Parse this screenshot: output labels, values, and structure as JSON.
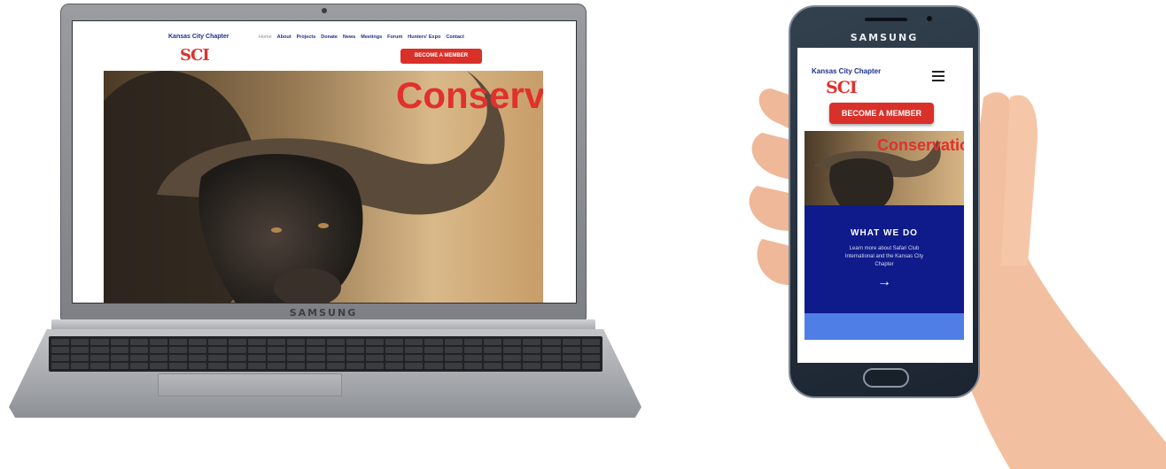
{
  "laptop": {
    "brand": "SAMSUNG",
    "site": {
      "chapter": "Kansas City Chapter",
      "logo": "SCI",
      "nav": [
        "Home",
        "About",
        "Projects",
        "Donate",
        "News",
        "Meetings",
        "Forum",
        "Hunters' Expo",
        "Contact"
      ],
      "active_nav": "Home",
      "cta": "BECOME A MEMBER",
      "hero_title": "Conservation"
    }
  },
  "phone": {
    "brand": "SAMSUNG",
    "site": {
      "chapter": "Kansas City Chapter",
      "logo": "SCI",
      "cta": "BECOME A MEMBER",
      "hero_title": "Conservation",
      "what_title": "WHAT WE DO",
      "what_text": "Learn more about Safari Club International and the Kansas City Chapter",
      "arrow": "→"
    }
  },
  "colors": {
    "brand_red": "#d9302a",
    "navy": "#1c2f8c",
    "what_bg": "#0f1b8a",
    "band_blue": "#4f7fe6"
  }
}
